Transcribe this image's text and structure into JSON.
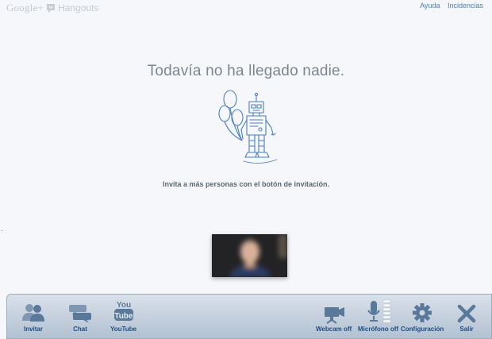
{
  "brand": {
    "google": "Google+",
    "product": "Hangouts"
  },
  "top_links": [
    "Ayuda",
    "Incidencias"
  ],
  "main": {
    "headline": "Todavía no ha llegado nadie.",
    "invite_hint": "Invita a más personas con el botón de invitación."
  },
  "toolbar": {
    "left": [
      {
        "label": "Invitar",
        "icon": "people-icon"
      },
      {
        "label": "Chat",
        "icon": "chat-icon"
      },
      {
        "label": "YouTube",
        "icon": "youtube-icon",
        "icon_text_top": "You",
        "icon_text_bottom": "Tube"
      }
    ],
    "right": [
      {
        "label": "Webcam off",
        "icon": "webcam-icon"
      },
      {
        "label": "Micrófono off",
        "icon": "microphone-icon"
      },
      {
        "label": "Configuración",
        "icon": "gear-icon"
      },
      {
        "label": "Salir",
        "icon": "close-icon"
      }
    ]
  },
  "colors": {
    "link": "#4a7fc0",
    "toolbar_label": "#1d4f86",
    "headline": "#7d8690",
    "drawing": "#4c7fc4"
  }
}
